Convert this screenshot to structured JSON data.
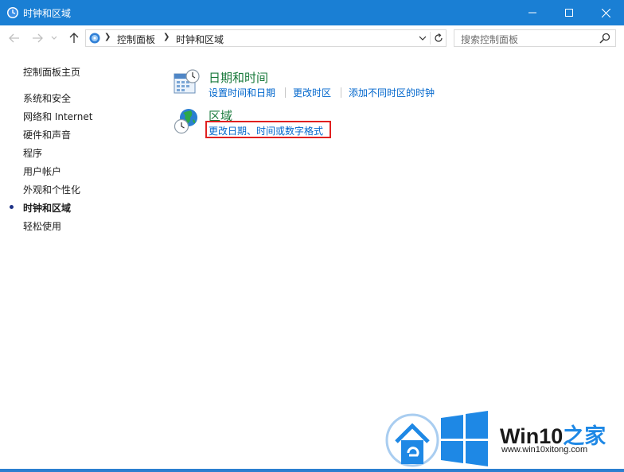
{
  "window": {
    "title": "时钟和区域",
    "minimize_icon": "minimize-icon",
    "maximize_icon": "maximize-icon",
    "close_icon": "close-icon"
  },
  "address_bar": {
    "breadcrumbs": [
      "控制面板",
      "时钟和区域"
    ],
    "search_placeholder": "搜索控制面板"
  },
  "sidebar": {
    "home": "控制面板主页",
    "items": [
      {
        "label": "系统和安全"
      },
      {
        "label": "网络和 Internet"
      },
      {
        "label": "硬件和声音"
      },
      {
        "label": "程序"
      },
      {
        "label": "用户帐户"
      },
      {
        "label": "外观和个性化"
      },
      {
        "label": "时钟和区域",
        "current": true
      },
      {
        "label": "轻松使用"
      }
    ]
  },
  "categories": [
    {
      "title": "日期和时间",
      "icon": "calendar-clock-icon",
      "links": [
        "设置时间和日期",
        "更改时区",
        "添加不同时区的时钟"
      ]
    },
    {
      "title": "区域",
      "icon": "globe-clock-icon",
      "links": [
        "更改日期、时间或数字格式"
      ]
    }
  ],
  "watermark": {
    "brand_prefix": "Win10",
    "brand_suffix": "之家",
    "url": "www.win10xitong.com"
  },
  "colors": {
    "titlebar": "#1a7fd4",
    "category_title": "#1a7a3c",
    "link": "#0066cc",
    "highlight_box": "#e02020",
    "watermark_blue": "#1e88e5"
  }
}
